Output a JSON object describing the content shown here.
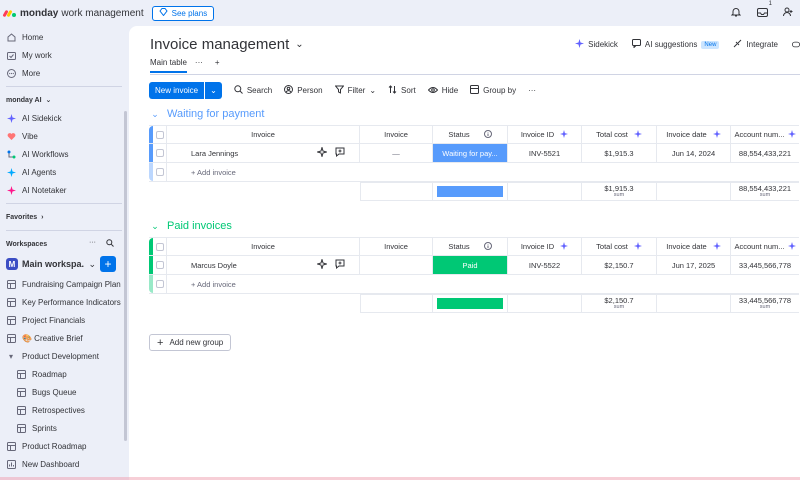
{
  "topbar": {
    "brand": "monday",
    "product": "work management",
    "see_plans": "See plans",
    "inbox_count": "1"
  },
  "sidebar": {
    "top_items": [
      {
        "label": "Home",
        "icon": "home-icon"
      },
      {
        "label": "My work",
        "icon": "calendar-check-icon"
      },
      {
        "label": "More",
        "icon": "more-circle-icon"
      }
    ],
    "ai_section": "monday AI",
    "ai_items": [
      {
        "label": "AI Sidekick"
      },
      {
        "label": "Vibe"
      },
      {
        "label": "AI Workflows"
      },
      {
        "label": "AI Agents"
      },
      {
        "label": "AI Notetaker"
      }
    ],
    "favorites": "Favorites",
    "workspaces": "Workspaces",
    "workspace_initial": "M",
    "workspace_name": "Main workspa...",
    "boards": [
      {
        "label": "Fundraising Campaign Plan",
        "sub": false
      },
      {
        "label": "Key Performance Indicators",
        "sub": false
      },
      {
        "label": "Project Financials",
        "sub": false
      },
      {
        "label": "🎨 Creative Brief",
        "sub": false
      },
      {
        "label": "Product Development",
        "sub": false,
        "folder": true
      },
      {
        "label": "Roadmap",
        "sub": true
      },
      {
        "label": "Bugs Queue",
        "sub": true
      },
      {
        "label": "Retrospectives",
        "sub": true
      },
      {
        "label": "Sprints",
        "sub": true
      },
      {
        "label": "Product Roadmap",
        "sub": false
      },
      {
        "label": "New Dashboard",
        "sub": false
      }
    ]
  },
  "board": {
    "title": "Invoice management",
    "tab_main": "Main table",
    "tab_more": "···",
    "tab_add": "+",
    "actions": {
      "sidekick": "Sidekick",
      "ai_suggestions": "AI suggestions",
      "new_badge": "New",
      "integrate": "Integrate"
    },
    "toolbar": {
      "new_invoice": "New invoice",
      "search": "Search",
      "person": "Person",
      "filter": "Filter",
      "sort": "Sort",
      "hide": "Hide",
      "group_by": "Group by",
      "more": "···"
    },
    "columns": {
      "name": "Invoice",
      "invoice": "Invoice",
      "status": "Status",
      "id": "Invoice ID",
      "cost": "Total cost",
      "date": "Invoice date",
      "acct": "Account num..."
    },
    "add_item": "+ Add invoice",
    "sum_label": "sum",
    "add_group": "Add new group"
  },
  "groups": [
    {
      "title": "Waiting for payment",
      "color": "#579bfc",
      "row": {
        "name": "Lara Jennings",
        "invoice": "—",
        "status": "Waiting for pay...",
        "status_color": "#579bfc",
        "id": "INV-5521",
        "cost": "$1,915.3",
        "date": "Jun 14, 2024",
        "acct": "88,554,433,221"
      },
      "sum_cost": "$1,915.3",
      "sum_acct": "88,554,433,221"
    },
    {
      "title": "Paid invoices",
      "color": "#00c875",
      "row": {
        "name": "Marcus Doyle",
        "invoice": "",
        "status": "Paid",
        "status_color": "#00c875",
        "id": "INV-5522",
        "cost": "$2,150.7",
        "date": "Jun 17, 2025",
        "acct": "33,445,566,778"
      },
      "sum_cost": "$2,150.7",
      "sum_acct": "33,445,566,778"
    }
  ]
}
